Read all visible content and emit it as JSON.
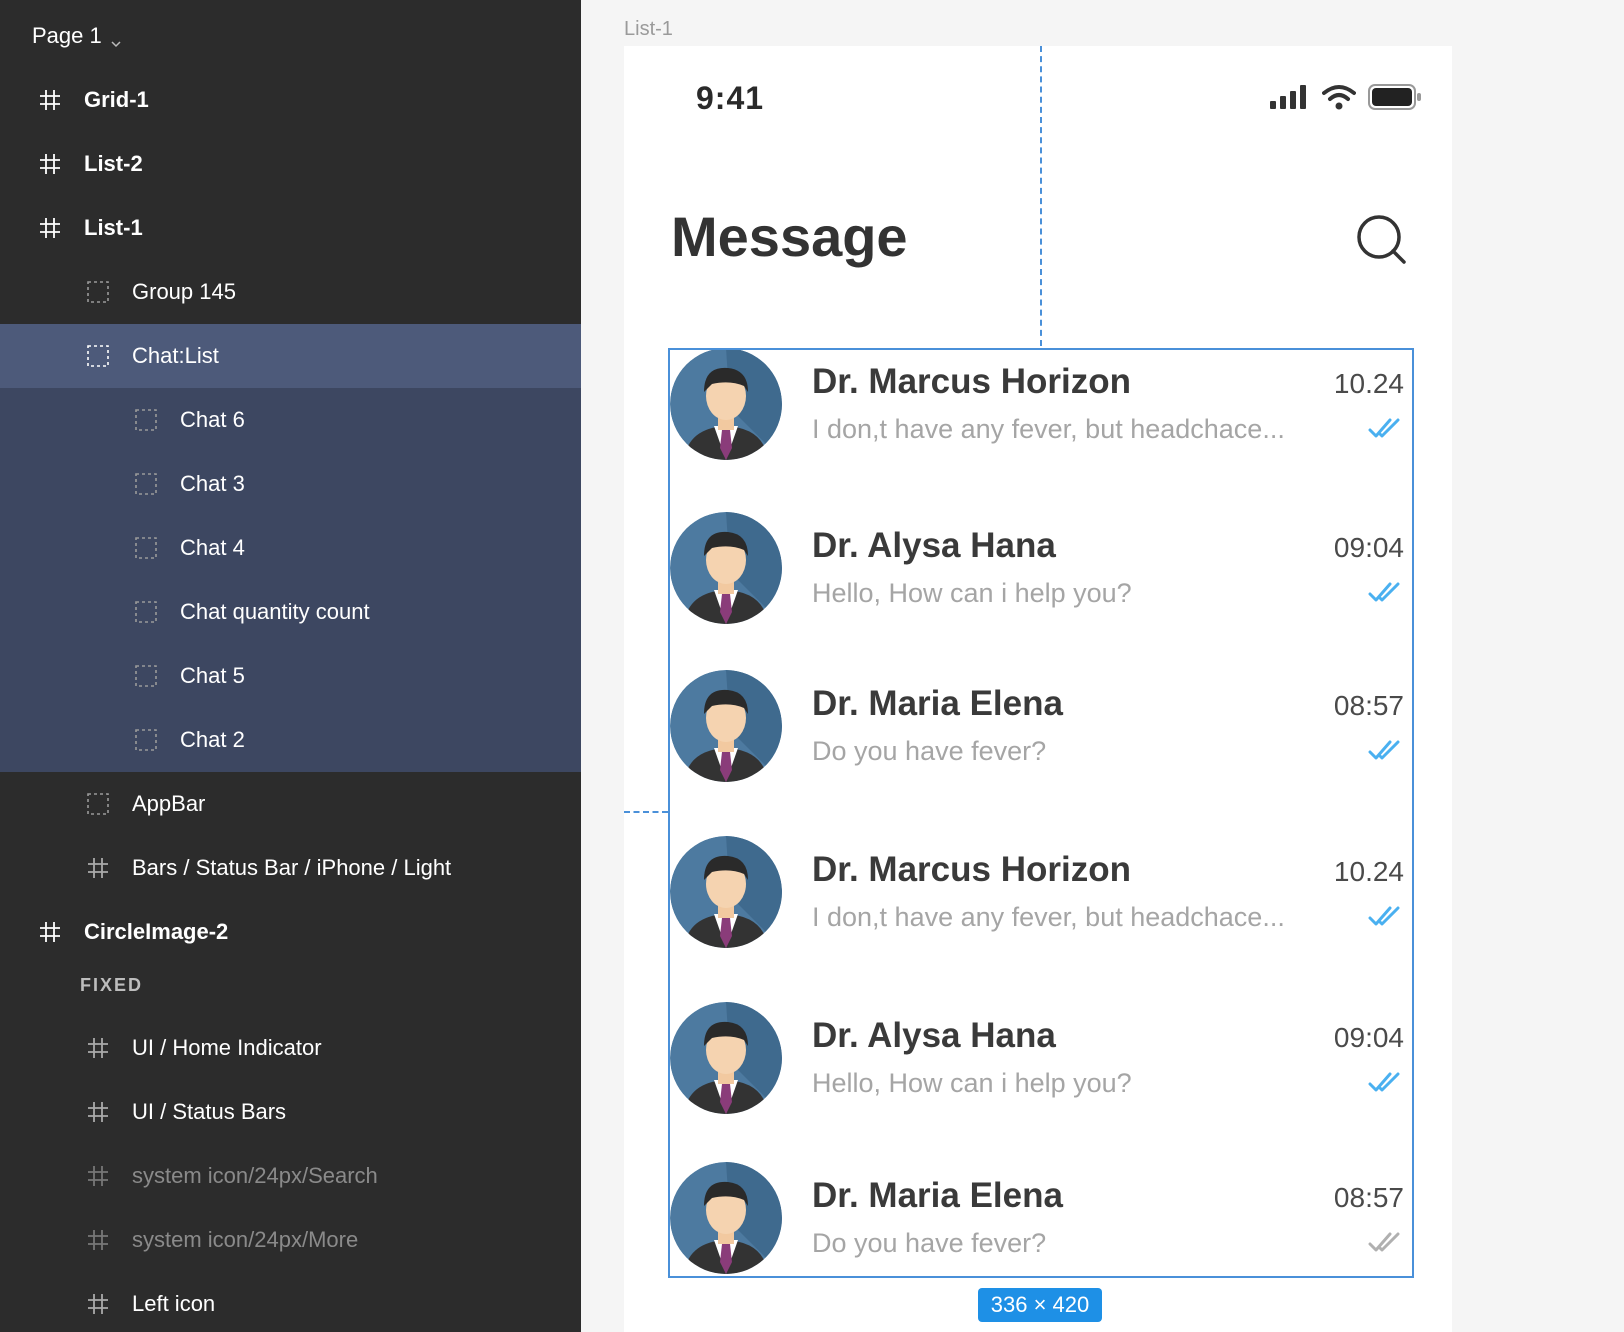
{
  "page": {
    "label": "Page 1"
  },
  "layers": [
    {
      "label": "Grid-1",
      "icon": "frame-icon",
      "indent": 0,
      "bold": true,
      "state": ""
    },
    {
      "label": "List-2",
      "icon": "frame-icon",
      "indent": 0,
      "bold": true,
      "state": ""
    },
    {
      "label": "List-1",
      "icon": "frame-icon",
      "indent": 0,
      "bold": true,
      "state": ""
    },
    {
      "label": "Group 145",
      "icon": "group-icon",
      "indent": 1,
      "bold": false,
      "state": ""
    },
    {
      "label": "Chat:List",
      "icon": "group-icon",
      "indent": 1,
      "bold": false,
      "state": "selected"
    },
    {
      "label": "Chat 6",
      "icon": "group-icon",
      "indent": 2,
      "bold": false,
      "state": "child"
    },
    {
      "label": "Chat 3",
      "icon": "group-icon",
      "indent": 2,
      "bold": false,
      "state": "child"
    },
    {
      "label": "Chat 4",
      "icon": "group-icon",
      "indent": 2,
      "bold": false,
      "state": "child"
    },
    {
      "label": "Chat quantity count",
      "icon": "group-icon",
      "indent": 2,
      "bold": false,
      "state": "child"
    },
    {
      "label": "Chat 5",
      "icon": "group-icon",
      "indent": 2,
      "bold": false,
      "state": "child"
    },
    {
      "label": "Chat 2",
      "icon": "group-icon",
      "indent": 2,
      "bold": false,
      "state": "child"
    },
    {
      "label": "AppBar",
      "icon": "group-icon",
      "indent": 1,
      "bold": false,
      "state": ""
    },
    {
      "label": "Bars / Status Bar / iPhone / Light",
      "icon": "frame-icon",
      "indent": 1,
      "bold": false,
      "state": ""
    },
    {
      "label": "CircleImage-2",
      "icon": "frame-icon",
      "indent": 0,
      "bold": true,
      "state": ""
    },
    {
      "label": "UI / Home Indicator",
      "icon": "frame-icon",
      "indent": 1,
      "bold": false,
      "state": ""
    },
    {
      "label": "UI / Status Bars",
      "icon": "frame-icon",
      "indent": 1,
      "bold": false,
      "state": ""
    },
    {
      "label": "system icon/24px/Search",
      "icon": "frame-icon",
      "indent": 1,
      "bold": false,
      "state": "dim"
    },
    {
      "label": "system icon/24px/More",
      "icon": "frame-icon",
      "indent": 1,
      "bold": false,
      "state": "dim"
    },
    {
      "label": "Left icon",
      "icon": "frame-icon",
      "indent": 1,
      "bold": false,
      "state": ""
    }
  ],
  "section_label": "FIXED",
  "frame": {
    "label": "List-1",
    "status_time": "9:41",
    "title": "Message",
    "selection_size": "336 × 420"
  },
  "chats": [
    {
      "name": "Dr. Marcus Horizon",
      "message": "I don,t have any fever, but headchace...",
      "time": "10.24",
      "read": true
    },
    {
      "name": "Dr. Alysa Hana",
      "message": "Hello, How can i help you?",
      "time": "09:04",
      "read": true
    },
    {
      "name": "Dr. Maria Elena",
      "message": "Do you have fever?",
      "time": "08:57",
      "read": true
    },
    {
      "name": "Dr. Marcus Horizon",
      "message": "I don,t have any fever, but headchace...",
      "time": "10.24",
      "read": true
    },
    {
      "name": "Dr. Alysa Hana",
      "message": "Hello, How can i help you?",
      "time": "09:04",
      "read": true
    },
    {
      "name": "Dr. Maria Elena",
      "message": "Do you have fever?",
      "time": "08:57",
      "read": false
    }
  ],
  "colors": {
    "panel_bg": "#2c2c2c",
    "selected_layer": "#4d5a7a",
    "selected_children": "#3d4761",
    "selection_blue": "#4a90d9",
    "read_check": "#4ab0f0",
    "unread_check": "#b0b0b0"
  }
}
